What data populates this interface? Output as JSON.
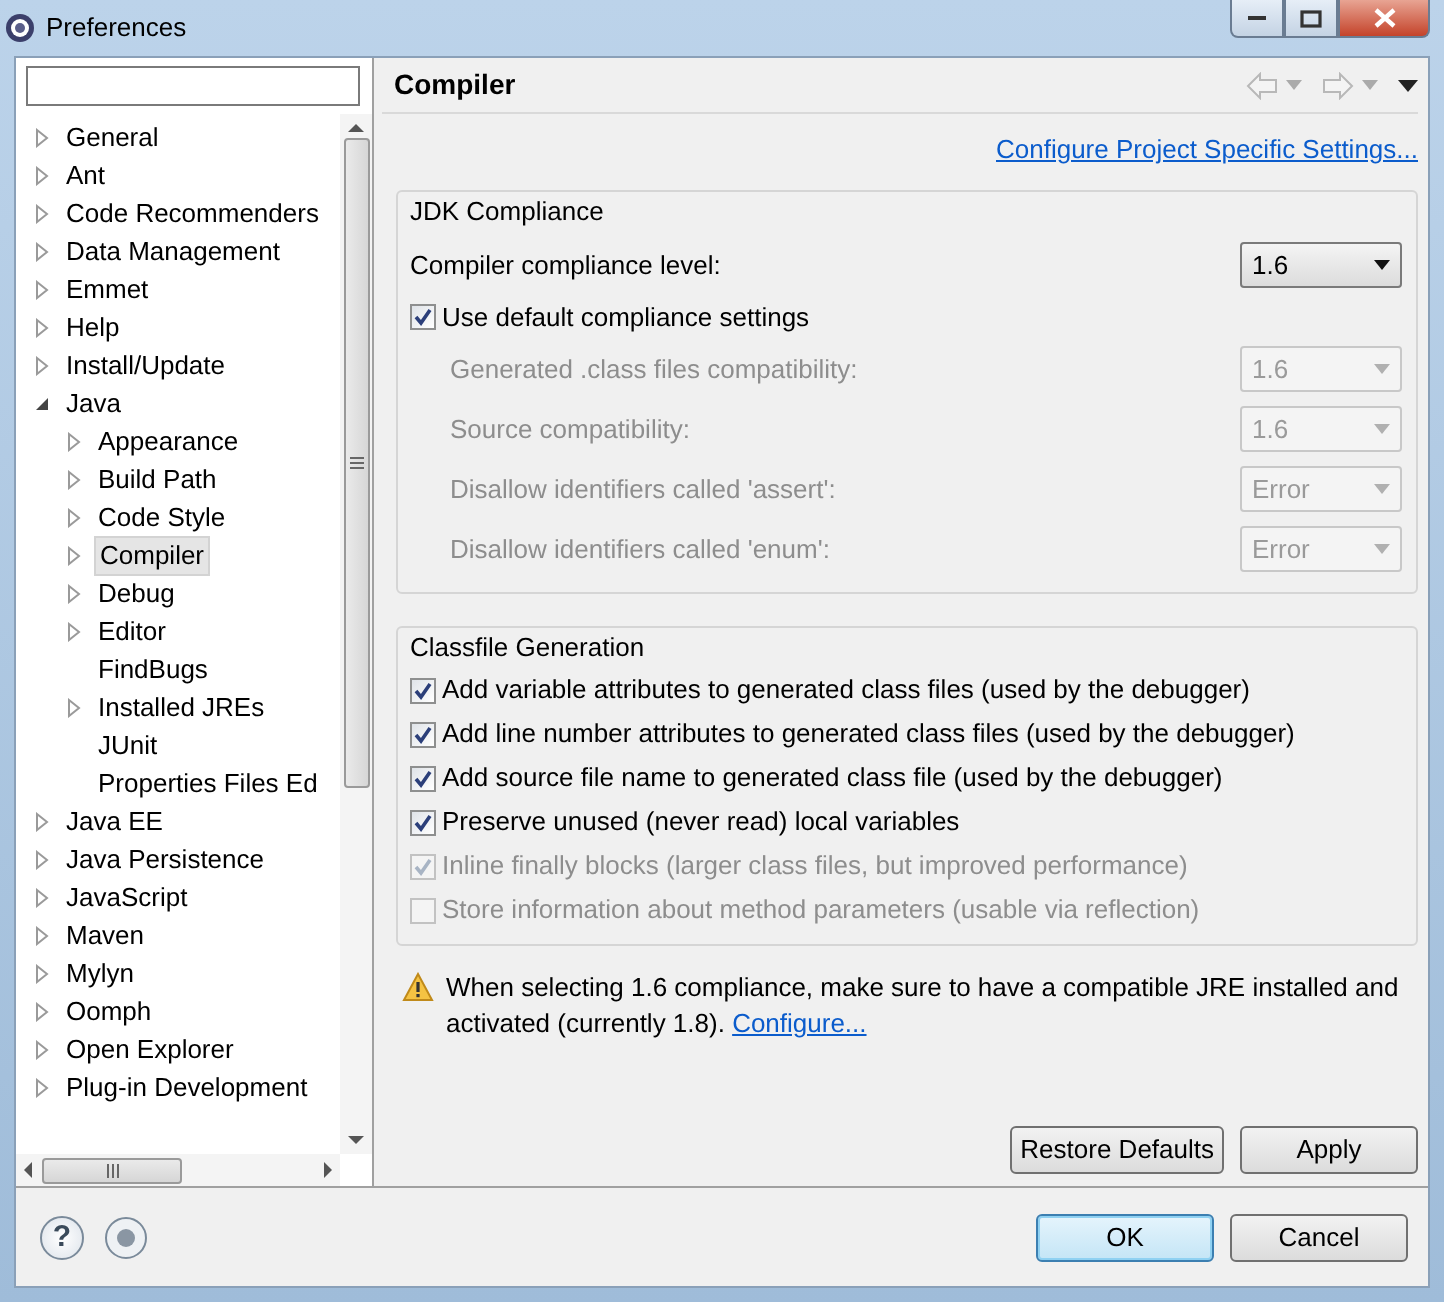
{
  "window": {
    "title": "Preferences"
  },
  "tree": [
    {
      "label": "General",
      "expandable": true,
      "expanded": false,
      "selected": false
    },
    {
      "label": "Ant",
      "expandable": true,
      "expanded": false,
      "selected": false
    },
    {
      "label": "Code Recommenders",
      "expandable": true,
      "expanded": false,
      "selected": false
    },
    {
      "label": "Data Management",
      "expandable": true,
      "expanded": false,
      "selected": false
    },
    {
      "label": "Emmet",
      "expandable": true,
      "expanded": false,
      "selected": false
    },
    {
      "label": "Help",
      "expandable": true,
      "expanded": false,
      "selected": false
    },
    {
      "label": "Install/Update",
      "expandable": true,
      "expanded": false,
      "selected": false
    },
    {
      "label": "Java",
      "expandable": true,
      "expanded": true,
      "selected": false,
      "children": [
        {
          "label": "Appearance",
          "expandable": true,
          "expanded": false,
          "selected": false
        },
        {
          "label": "Build Path",
          "expandable": true,
          "expanded": false,
          "selected": false
        },
        {
          "label": "Code Style",
          "expandable": true,
          "expanded": false,
          "selected": false
        },
        {
          "label": "Compiler",
          "expandable": true,
          "expanded": false,
          "selected": true
        },
        {
          "label": "Debug",
          "expandable": true,
          "expanded": false,
          "selected": false
        },
        {
          "label": "Editor",
          "expandable": true,
          "expanded": false,
          "selected": false
        },
        {
          "label": "FindBugs",
          "expandable": false,
          "expanded": false,
          "selected": false
        },
        {
          "label": "Installed JREs",
          "expandable": true,
          "expanded": false,
          "selected": false
        },
        {
          "label": "JUnit",
          "expandable": false,
          "expanded": false,
          "selected": false
        },
        {
          "label": "Properties Files Ed",
          "expandable": false,
          "expanded": false,
          "selected": false
        }
      ]
    },
    {
      "label": "Java EE",
      "expandable": true,
      "expanded": false,
      "selected": false
    },
    {
      "label": "Java Persistence",
      "expandable": true,
      "expanded": false,
      "selected": false
    },
    {
      "label": "JavaScript",
      "expandable": true,
      "expanded": false,
      "selected": false
    },
    {
      "label": "Maven",
      "expandable": true,
      "expanded": false,
      "selected": false
    },
    {
      "label": "Mylyn",
      "expandable": true,
      "expanded": false,
      "selected": false
    },
    {
      "label": "Oomph",
      "expandable": true,
      "expanded": false,
      "selected": false
    },
    {
      "label": "Open Explorer",
      "expandable": true,
      "expanded": false,
      "selected": false
    },
    {
      "label": "Plug-in Development",
      "expandable": true,
      "expanded": false,
      "selected": false
    }
  ],
  "page": {
    "title": "Compiler",
    "link": "Configure Project Specific Settings..."
  },
  "jdk_compliance": {
    "title": "JDK Compliance",
    "level": {
      "label": "Compiler compliance level:",
      "value": "1.6",
      "disabled": false
    },
    "use_default": {
      "label": "Use default compliance settings",
      "checked": true,
      "disabled": false
    },
    "settings": [
      {
        "label": "Generated .class files compatibility:",
        "value": "1.6",
        "disabled": true
      },
      {
        "label": "Source compatibility:",
        "value": "1.6",
        "disabled": true
      },
      {
        "label": "Disallow identifiers called 'assert':",
        "value": "Error",
        "disabled": true
      },
      {
        "label": "Disallow identifiers called 'enum':",
        "value": "Error",
        "disabled": true
      }
    ]
  },
  "classfile_generation": {
    "title": "Classfile Generation",
    "options": [
      {
        "label": "Add variable attributes to generated class files (used by the debugger)",
        "checked": true,
        "disabled": false
      },
      {
        "label": "Add line number attributes to generated class files (used by the debugger)",
        "checked": true,
        "disabled": false
      },
      {
        "label": "Add source file name to generated class file (used by the debugger)",
        "checked": true,
        "disabled": false
      },
      {
        "label": "Preserve unused (never read) local variables",
        "checked": true,
        "disabled": false
      },
      {
        "label": "Inline finally blocks (larger class files, but improved performance)",
        "checked": true,
        "disabled": true
      },
      {
        "label": "Store information about method parameters (usable via reflection)",
        "checked": false,
        "disabled": true
      }
    ]
  },
  "warning": {
    "text": "When selecting 1.6 compliance, make sure to have a compatible JRE installed and activated (currently 1.8).",
    "link": "Configure..."
  },
  "page_buttons": [
    "Restore Defaults",
    "Apply"
  ],
  "help": {
    "label": "?"
  },
  "dialog_buttons": [
    {
      "label": "OK",
      "default": true
    },
    {
      "label": "Cancel",
      "default": false
    }
  ]
}
